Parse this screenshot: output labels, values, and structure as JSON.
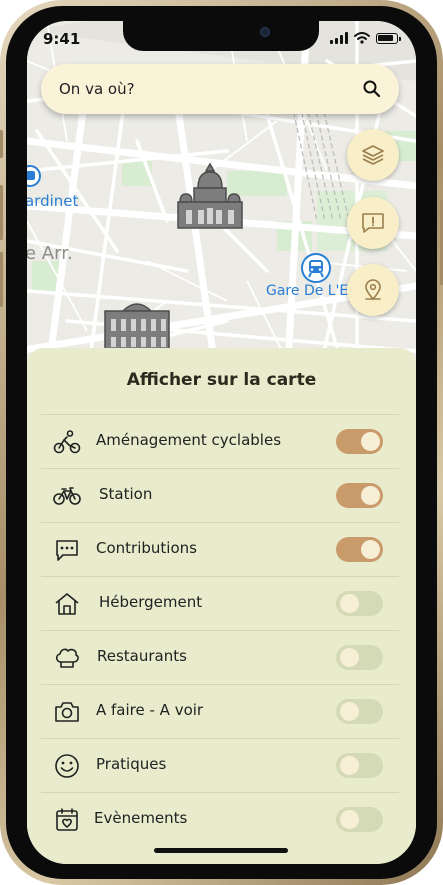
{
  "status_bar": {
    "time": "9:41"
  },
  "search": {
    "placeholder": "On va où?"
  },
  "map": {
    "labels": {
      "station_left": "ardinet",
      "district": "e Arr.",
      "station_right": "Gare De L'E"
    }
  },
  "fab_buttons": [
    {
      "icon": "layers-icon"
    },
    {
      "icon": "report-icon"
    },
    {
      "icon": "location-pin-icon"
    }
  ],
  "panel": {
    "title": "Afficher sur la carte",
    "items": [
      {
        "icon": "bike-path-icon",
        "label": "Aménagement cyclables",
        "enabled": true
      },
      {
        "icon": "bicycle-icon",
        "label": "Station",
        "enabled": true
      },
      {
        "icon": "chat-icon",
        "label": "Contributions",
        "enabled": true
      },
      {
        "icon": "house-icon",
        "label": "Hébergement",
        "enabled": false
      },
      {
        "icon": "chef-hat-icon",
        "label": "Restaurants",
        "enabled": false
      },
      {
        "icon": "camera-icon",
        "label": "A faire - A voir",
        "enabled": false
      },
      {
        "icon": "smiley-icon",
        "label": "Pratiques",
        "enabled": false
      },
      {
        "icon": "calendar-heart-icon",
        "label": "Evènements",
        "enabled": false
      }
    ]
  },
  "colors": {
    "panel_bg": "#e8ebcc",
    "toggle_on": "#c99a6a",
    "toggle_off": "#d4d9b6",
    "search_bg": "#fbf3d8",
    "fab_bg": "#f8eec8",
    "map_label_blue": "#2a7fd4"
  }
}
